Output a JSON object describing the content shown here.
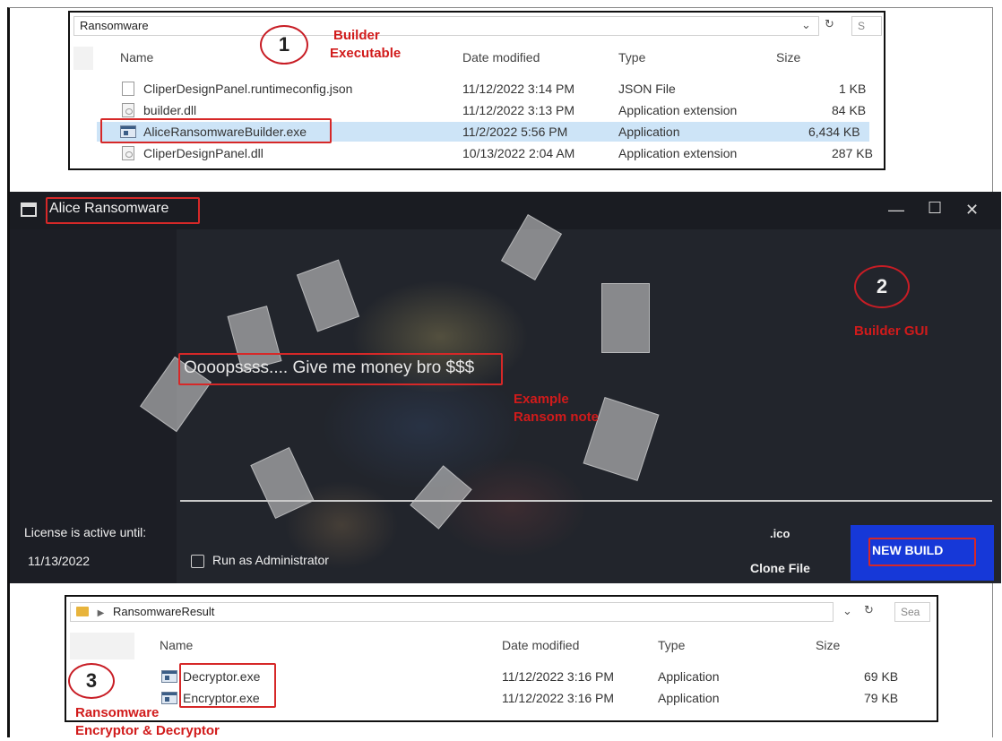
{
  "explorer_top": {
    "address": "Ransomware",
    "search_stub": "S",
    "columns": {
      "name": "Name",
      "date": "Date modified",
      "type": "Type",
      "size": "Size"
    },
    "rows": [
      {
        "name": "CliperDesignPanel.runtimeconfig.json",
        "date": "11/12/2022 3:14 PM",
        "type": "JSON File",
        "size": "1 KB",
        "icon": "json-file-icon"
      },
      {
        "name": "builder.dll",
        "date": "11/12/2022 3:13 PM",
        "type": "Application extension",
        "size": "84 KB",
        "icon": "dll-file-icon"
      },
      {
        "name": "AliceRansomwareBuilder.exe",
        "date": "11/2/2022 5:56 PM",
        "type": "Application",
        "size": "6,434 KB",
        "icon": "exe-file-icon"
      },
      {
        "name": "CliperDesignPanel.dll",
        "date": "10/13/2022 2:04 AM",
        "type": "Application extension",
        "size": "287 KB",
        "icon": "dll-file-icon"
      }
    ]
  },
  "annotations": {
    "step1_number": "1",
    "step1_line1": "Builder",
    "step1_line2": "Executable",
    "step2_number": "2",
    "step2_label": "Builder GUI",
    "note_line1": "Example",
    "note_line2": "Ransom note",
    "step3_number": "3",
    "step3_line1": "Ransomware",
    "step3_line2": "Encryptor & Decryptor",
    "accent_color": "#d11b1b"
  },
  "builder": {
    "window_title": "Alice Ransomware",
    "ransom_note": "Oooopssss.... Give me money bro $$$",
    "license_label": "License is active until:",
    "license_date": "11/13/2022",
    "run_as_admin_label": "Run as Administrator",
    "ico_label": ".ico",
    "clone_file_label": "Clone File",
    "new_build_label": "NEW BUILD",
    "new_build_color": "#1638d8"
  },
  "explorer_bottom": {
    "address": "RansomwareResult",
    "search_stub": "Sea",
    "columns": {
      "name": "Name",
      "date": "Date modified",
      "type": "Type",
      "size": "Size"
    },
    "rows": [
      {
        "name": "Decryptor.exe",
        "date": "11/12/2022 3:16 PM",
        "type": "Application",
        "size": "69 KB",
        "icon": "exe-file-icon"
      },
      {
        "name": "Encryptor.exe",
        "date": "11/12/2022 3:16 PM",
        "type": "Application",
        "size": "79 KB",
        "icon": "exe-file-icon"
      }
    ]
  }
}
